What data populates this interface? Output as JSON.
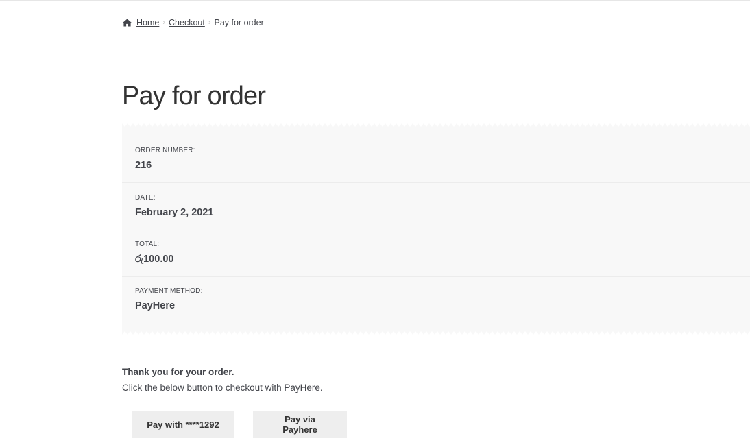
{
  "breadcrumb": {
    "home_label": "Home",
    "checkout_label": "Checkout",
    "current_label": "Pay for order",
    "separator": "›"
  },
  "page": {
    "title": "Pay for order"
  },
  "order_overview": {
    "order_number_label": "ORDER NUMBER:",
    "order_number": "216",
    "date_label": "DATE:",
    "date": "February 2, 2021",
    "total_label": "TOTAL:",
    "total": "රු100.00",
    "payment_method_label": "PAYMENT METHOD:",
    "payment_method": "PayHere"
  },
  "messages": {
    "thanks": "Thank you for your order.",
    "instruction": "Click the below button to checkout with PayHere."
  },
  "buttons": {
    "pay_saved_card": "Pay with ****1292",
    "pay_via_payhere": "Pay via Payhere"
  },
  "colors": {
    "text": "#43454b",
    "panel_bg": "#f8f8f8",
    "button_bg": "#eeeeee"
  }
}
